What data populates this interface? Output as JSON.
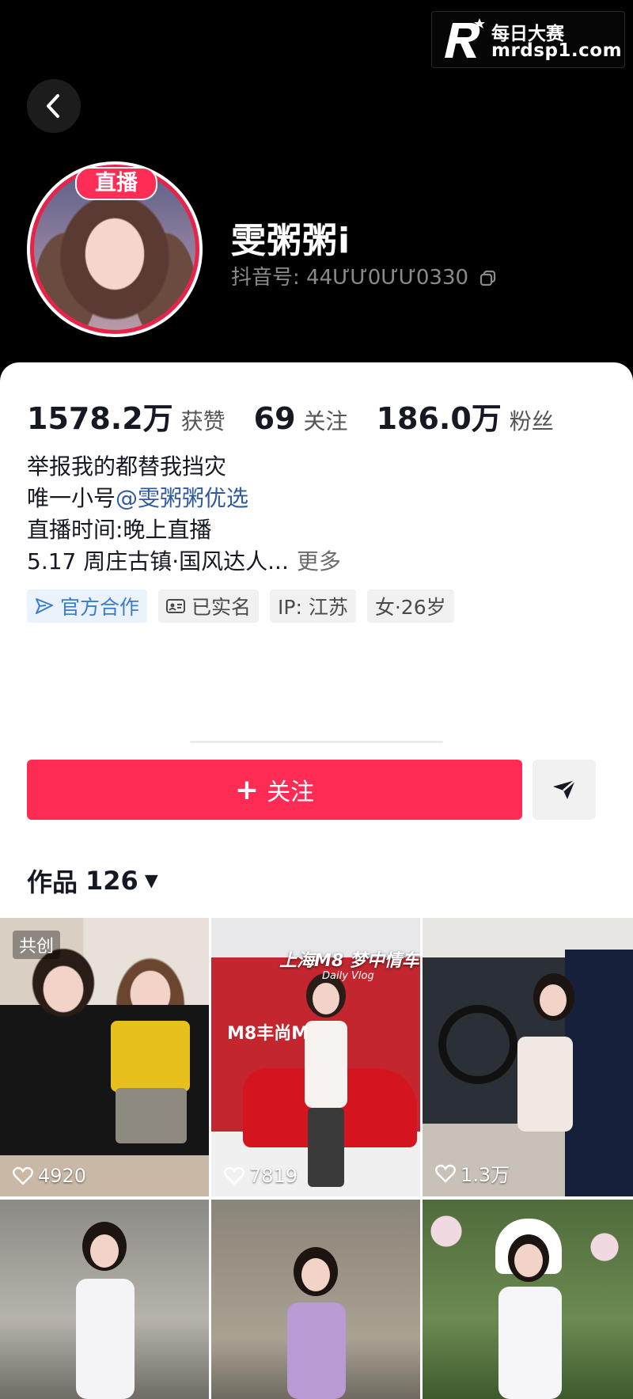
{
  "watermark": {
    "line1": "每日大赛",
    "line2": "mrdsp1.com"
  },
  "profile": {
    "live_label": "直播",
    "username": "雯粥粥i",
    "douyin_id": "抖音号: 44ƯƯ0ƯƯ0330"
  },
  "stats": [
    {
      "value": "1578.2万",
      "label": "获赞"
    },
    {
      "value": "69",
      "label": "关注"
    },
    {
      "value": "186.0万",
      "label": "粉丝"
    }
  ],
  "bio": {
    "line1": "举报我的都替我挡灾",
    "line2_prefix": "唯一小号",
    "line2_mention": "@雯粥粥优选",
    "line3": "直播时间:晚上直播",
    "line4": "5.17 周庄古镇·国风达人...",
    "more": "更多"
  },
  "tags": {
    "official": "官方合作",
    "verified": "已实名",
    "ip": "IP:  江苏",
    "gender_age": "女·26岁"
  },
  "actions": {
    "follow_label": "关注"
  },
  "works": {
    "title": "作品",
    "count": "126"
  },
  "videos": [
    {
      "likes": "4920",
      "badge": "共创"
    },
    {
      "likes": "7819",
      "overlay_title": "上海M8 梦中情车",
      "overlay_sub": "Daily Vlog",
      "banner": "M8丰尚M"
    },
    {
      "likes": "1.3万"
    },
    {
      "likes": ""
    },
    {
      "likes": ""
    },
    {
      "likes": ""
    }
  ]
}
